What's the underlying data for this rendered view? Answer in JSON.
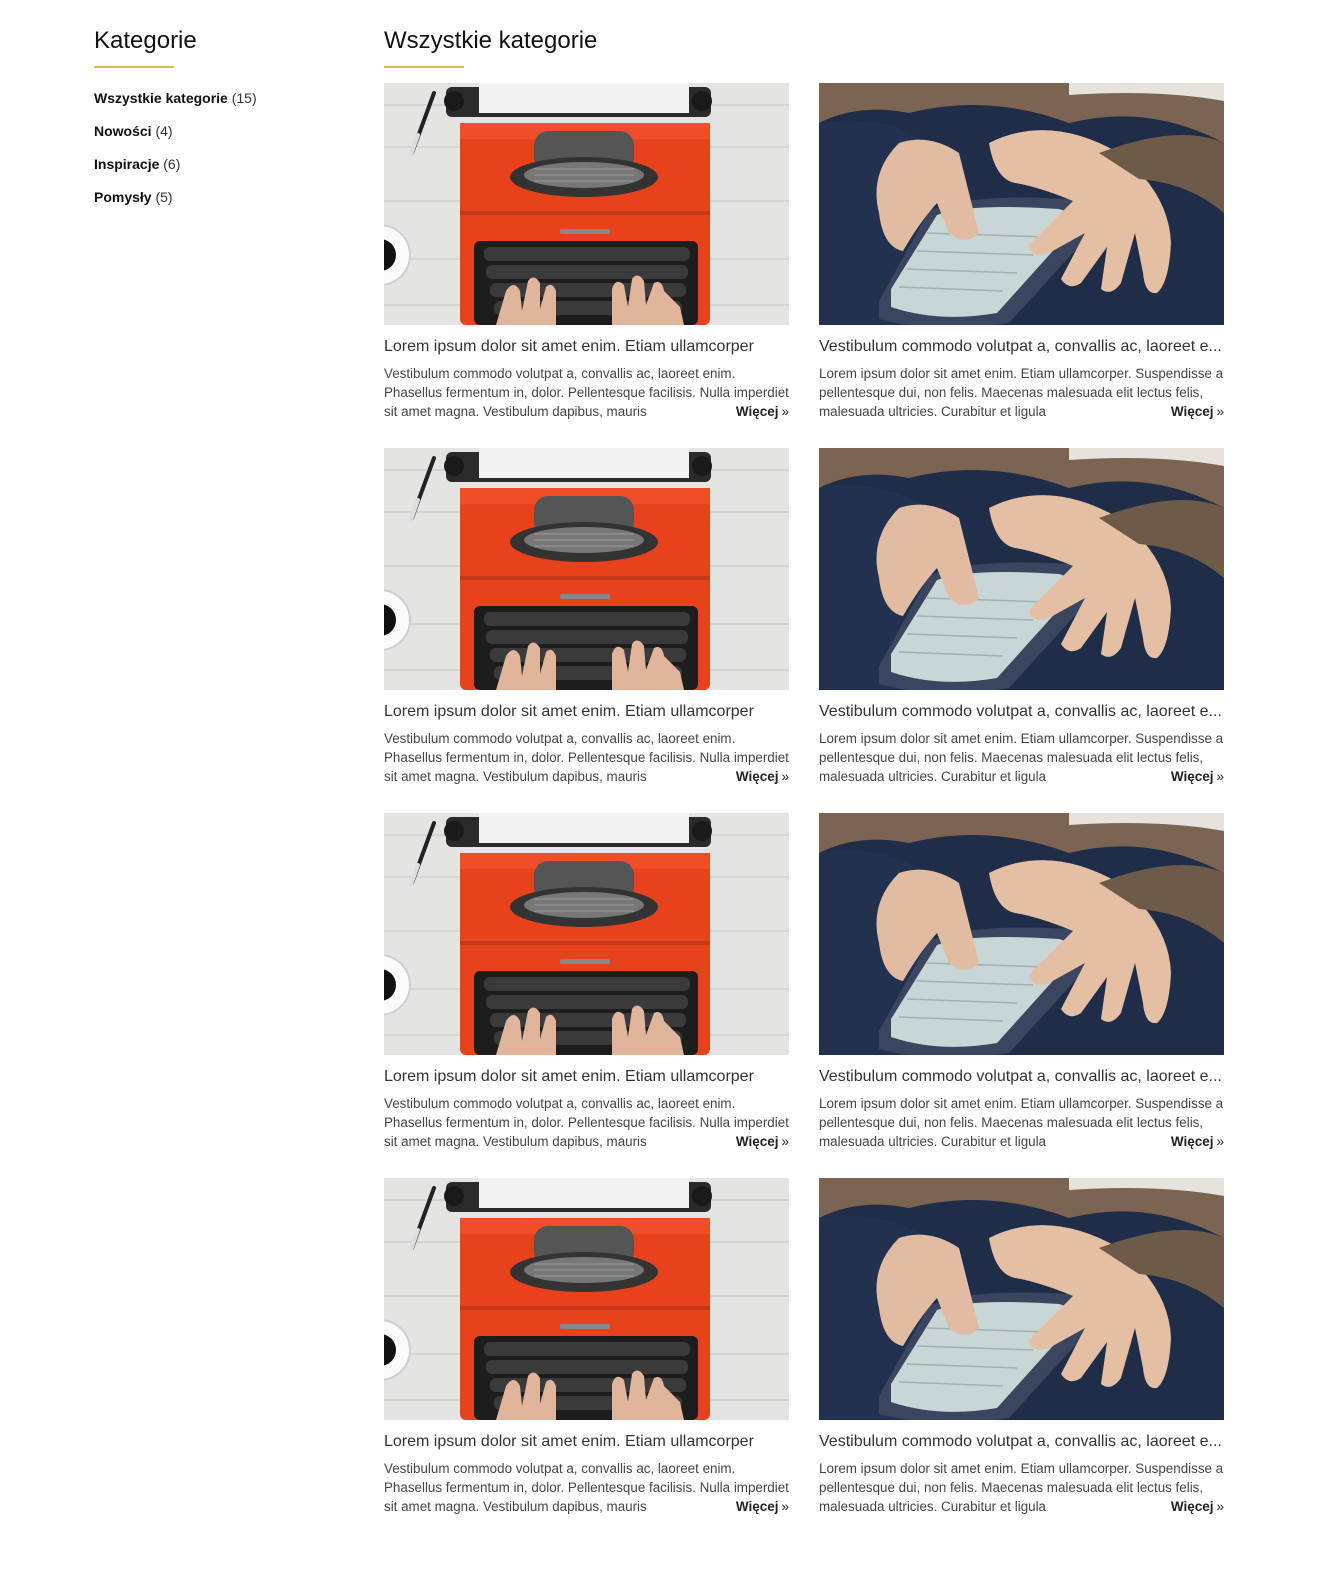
{
  "sidebar": {
    "heading": "Kategorie",
    "categories": [
      {
        "name": "Wszystkie kategorie",
        "count": "(15)"
      },
      {
        "name": "Nowości",
        "count": "(4)"
      },
      {
        "name": "Inspiracje",
        "count": "(6)"
      },
      {
        "name": "Pomysły",
        "count": "(5)"
      }
    ]
  },
  "main": {
    "heading": "Wszystkie kategorie",
    "accent_color": "#d9b75a",
    "more_label": "Więcej",
    "more_icon": "double-chevron-right-icon",
    "posts": [
      {
        "image": "typewriter-photo",
        "title": "Lorem ipsum dolor sit amet enim. Etiam ullamcorper",
        "excerpt": "Vestibulum commodo volutpat a, convallis ac, laoreet enim. Phasellus fermentum in, dolor. Pellentesque facilisis. Nulla imperdiet sit amet magna. Vestibulum dapibus, mauris"
      },
      {
        "image": "smartphone-photo",
        "title": "Vestibulum commodo volutpat a, convallis ac, laoreet e...",
        "excerpt": "Lorem ipsum dolor sit amet enim. Etiam ullamcorper. Suspendisse a pellentesque dui, non felis. Maecenas malesuada elit lectus felis, malesuada ultricies. Curabitur et ligula"
      },
      {
        "image": "typewriter-photo",
        "title": "Lorem ipsum dolor sit amet enim. Etiam ullamcorper",
        "excerpt": "Vestibulum commodo volutpat a, convallis ac, laoreet enim. Phasellus fermentum in, dolor. Pellentesque facilisis. Nulla imperdiet sit amet magna. Vestibulum dapibus, mauris"
      },
      {
        "image": "smartphone-photo",
        "title": "Vestibulum commodo volutpat a, convallis ac, laoreet e...",
        "excerpt": "Lorem ipsum dolor sit amet enim. Etiam ullamcorper. Suspendisse a pellentesque dui, non felis. Maecenas malesuada elit lectus felis, malesuada ultricies. Curabitur et ligula"
      },
      {
        "image": "typewriter-photo",
        "title": "Lorem ipsum dolor sit amet enim. Etiam ullamcorper",
        "excerpt": "Vestibulum commodo volutpat a, convallis ac, laoreet enim. Phasellus fermentum in, dolor. Pellentesque facilisis. Nulla imperdiet sit amet magna. Vestibulum dapibus, mauris"
      },
      {
        "image": "smartphone-photo",
        "title": "Vestibulum commodo volutpat a, convallis ac, laoreet e...",
        "excerpt": "Lorem ipsum dolor sit amet enim. Etiam ullamcorper. Suspendisse a pellentesque dui, non felis. Maecenas malesuada elit lectus felis, malesuada ultricies. Curabitur et ligula"
      },
      {
        "image": "typewriter-photo",
        "title": "Lorem ipsum dolor sit amet enim. Etiam ullamcorper",
        "excerpt": "Vestibulum commodo volutpat a, convallis ac, laoreet enim. Phasellus fermentum in, dolor. Pellentesque facilisis. Nulla imperdiet sit amet magna. Vestibulum dapibus, mauris"
      },
      {
        "image": "smartphone-photo",
        "title": "Vestibulum commodo volutpat a, convallis ac, laoreet e...",
        "excerpt": "Lorem ipsum dolor sit amet enim. Etiam ullamcorper. Suspendisse a pellentesque dui, non felis. Maecenas malesuada elit lectus felis, malesuada ultricies. Curabitur et ligula"
      }
    ]
  }
}
